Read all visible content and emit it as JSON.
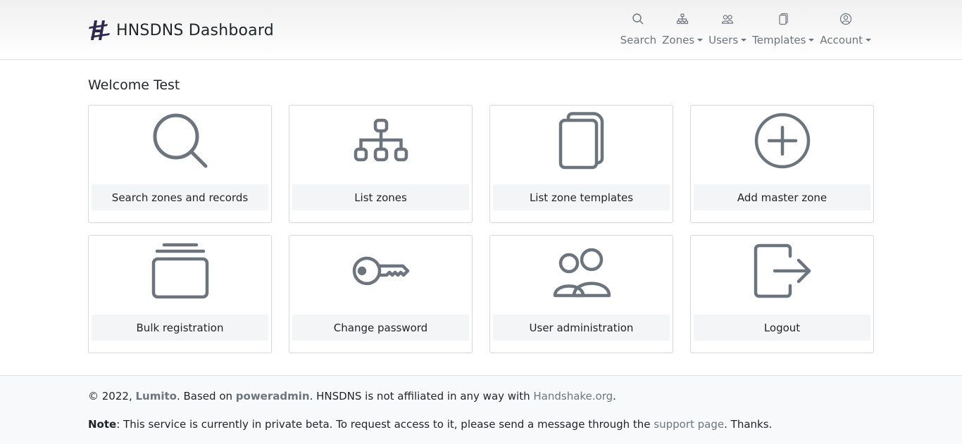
{
  "header": {
    "brand": "HNSDNS Dashboard",
    "nav": [
      {
        "label": "Search",
        "icon": "search-icon",
        "dropdown": false
      },
      {
        "label": "Zones",
        "icon": "sitemap-icon",
        "dropdown": true
      },
      {
        "label": "Users",
        "icon": "users-icon",
        "dropdown": true
      },
      {
        "label": "Templates",
        "icon": "copy-icon",
        "dropdown": true
      },
      {
        "label": "Account",
        "icon": "user-circle-icon",
        "dropdown": true
      }
    ]
  },
  "main": {
    "welcome": "Welcome Test",
    "cards": [
      {
        "label": "Search zones and records",
        "icon": "search-icon"
      },
      {
        "label": "List zones",
        "icon": "sitemap-icon"
      },
      {
        "label": "List zone templates",
        "icon": "copy-icon"
      },
      {
        "label": "Add master zone",
        "icon": "plus-circle-icon"
      },
      {
        "label": "Bulk registration",
        "icon": "stack-icon"
      },
      {
        "label": "Change password",
        "icon": "key-icon"
      },
      {
        "label": "User administration",
        "icon": "users-icon"
      },
      {
        "label": "Logout",
        "icon": "logout-icon"
      }
    ]
  },
  "footer": {
    "copyright": "© 2022, ",
    "lumito": "Lumito",
    "based_on": ". Based on ",
    "poweradmin": "poweradmin",
    "not_affiliated": ". HNSDNS is not affiliated in any way with ",
    "handshake": "Handshake.org",
    "period": ".",
    "note_label": "Note",
    "note_text": ": This service is currently in private beta. To request access to it, please send a message through the ",
    "support_link": "support page",
    "thanks": ". Thanks."
  },
  "colors": {
    "icon_gray": "#6c757d",
    "card_label_bg": "#f4f5f6",
    "footer_bg": "#f8f9fa",
    "logo": "#2d2a4f"
  }
}
